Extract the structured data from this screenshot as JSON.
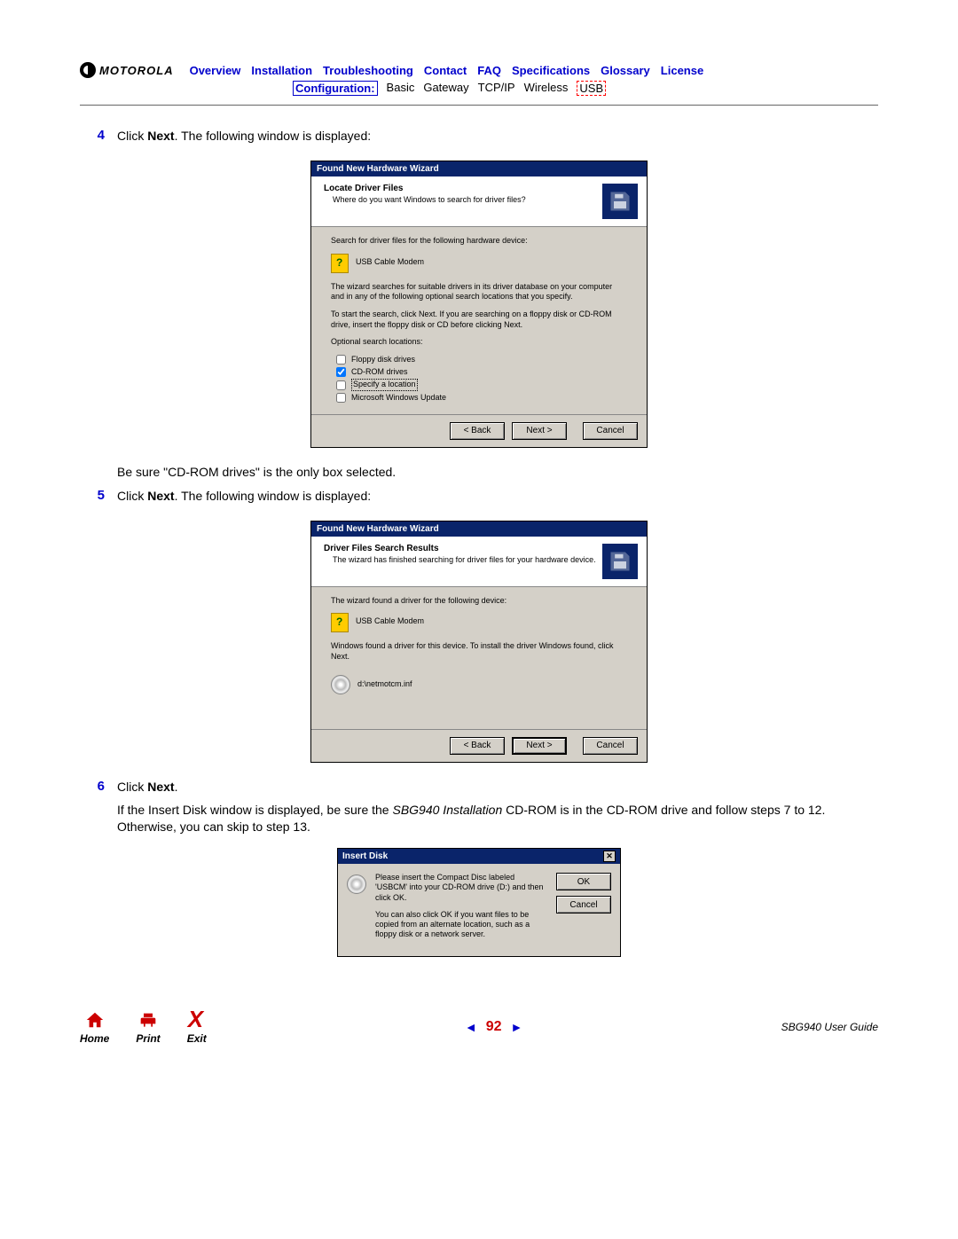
{
  "header": {
    "brand": "MOTOROLA",
    "nav1": [
      "Overview",
      "Installation",
      "Troubleshooting",
      "Contact",
      "FAQ",
      "Specifications",
      "Glossary",
      "License"
    ],
    "nav2": {
      "config": "Configuration:",
      "items": [
        "Basic",
        "Gateway",
        "TCP/IP",
        "Wireless"
      ],
      "usb": "USB"
    }
  },
  "steps": {
    "s4": {
      "num": "4",
      "text_pre": "Click ",
      "bold": "Next",
      "text_post": ". The following window is displayed:"
    },
    "note4": "Be sure \"CD-ROM drives\" is the only box selected.",
    "s5": {
      "num": "5",
      "text_pre": "Click ",
      "bold": "Next",
      "text_post": ". The following window is displayed:"
    },
    "s6": {
      "num": "6",
      "text_pre": "Click ",
      "bold": "Next",
      "text_post": "."
    },
    "note6_pre": "If the Insert Disk window is displayed, be sure the ",
    "note6_em": "SBG940 Installation",
    "note6_post": " CD-ROM is in the CD-ROM drive and follow steps 7 to 12. Otherwise, you can skip to step 13."
  },
  "wiz1": {
    "title": "Found New Hardware Wizard",
    "h1": "Locate Driver Files",
    "h2": "Where do you want Windows to search for driver files?",
    "p1": "Search for driver files for the following hardware device:",
    "device": "USB Cable Modem",
    "p2": "The wizard searches for suitable drivers in its driver database on your computer and in any of the following optional search locations that you specify.",
    "p3": "To start the search, click Next. If you are searching on a floppy disk or CD-ROM drive, insert the floppy disk or CD before clicking Next.",
    "p4": "Optional search locations:",
    "opts": [
      "Floppy disk drives",
      "CD-ROM drives",
      "Specify a location",
      "Microsoft Windows Update"
    ],
    "btns": {
      "back": "< Back",
      "next": "Next >",
      "cancel": "Cancel"
    }
  },
  "wiz2": {
    "title": "Found New Hardware Wizard",
    "h1": "Driver Files Search Results",
    "h2": "The wizard has finished searching for driver files for your hardware device.",
    "p1": "The wizard found a driver for the following device:",
    "device": "USB Cable Modem",
    "p2": "Windows found a driver for this device. To install the driver Windows found, click Next.",
    "path": "d:\\netmotcm.inf",
    "btns": {
      "back": "< Back",
      "next": "Next >",
      "cancel": "Cancel"
    }
  },
  "insert": {
    "title": "Insert Disk",
    "p1": "Please insert the Compact Disc labeled 'USBCM' into your CD-ROM drive (D:) and then click OK.",
    "p2": "You can also click OK if you want files to be copied from an alternate location, such as a floppy disk or a network server.",
    "ok": "OK",
    "cancel": "Cancel"
  },
  "footer": {
    "home": "Home",
    "print": "Print",
    "exit": "Exit",
    "page": "92",
    "guide": "SBG940 User Guide"
  }
}
